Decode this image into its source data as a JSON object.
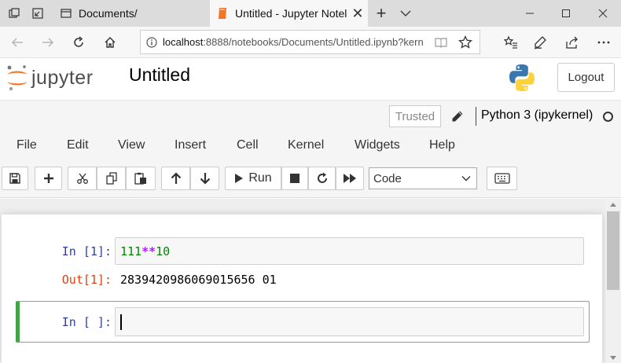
{
  "browser": {
    "tab_inactive_title": "Documents/",
    "tab_active_title": "Untitled - Jupyter Notel",
    "tab_close_glyph": "✕",
    "new_tab_glyph": "+",
    "url_host": "localhost",
    "url_path": ":8888/notebooks/Documents/Untitled.ipynb?kern"
  },
  "header": {
    "logo_text": "jupyter",
    "notebook_name": "Untitled",
    "logout_label": "Logout"
  },
  "status": {
    "trusted_label": "Trusted",
    "kernel_name": "Python 3 (ipykernel)"
  },
  "menu": {
    "items": [
      "File",
      "Edit",
      "View",
      "Insert",
      "Cell",
      "Kernel",
      "Widgets",
      "Help"
    ]
  },
  "toolbar": {
    "run_label": "Run",
    "cell_type": "Code"
  },
  "cells": [
    {
      "in_prompt": "In  [1]:",
      "code_left": "111",
      "code_op": "**",
      "code_right": "10",
      "out_prompt": "Out[1]:",
      "output": "2839420986069015656 01"
    },
    {
      "in_prompt": "In  [ ]:",
      "code": ""
    }
  ],
  "colors": {
    "jupyter_orange": "#f37626",
    "in_prompt": "#303f9f",
    "out_prompt": "#d84315",
    "selected_border": "#42a545"
  }
}
